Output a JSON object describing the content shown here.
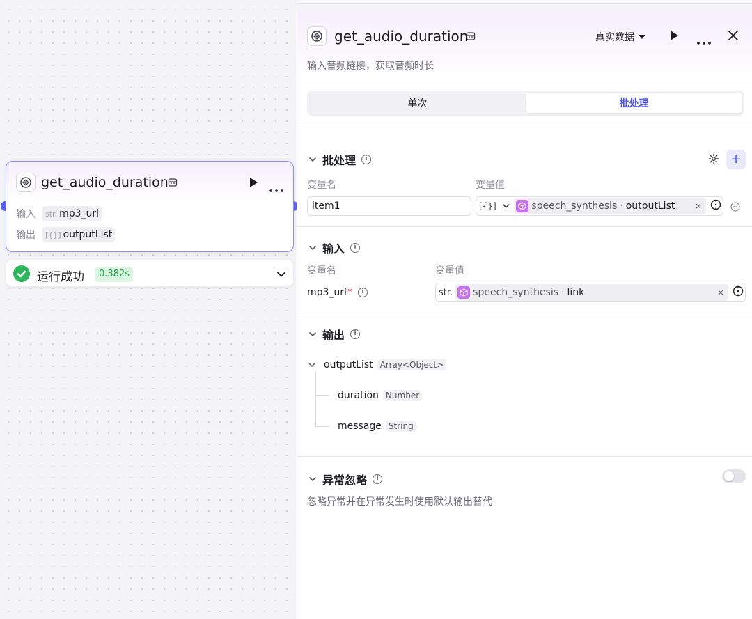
{
  "node": {
    "title": "get_audio_duration",
    "input_label": "输入",
    "input_type": "str.",
    "input_value": "mp3_url",
    "output_label": "输出",
    "output_type": "[{}]",
    "output_value": "outputList"
  },
  "run": {
    "status": "运行成功",
    "time": "0.382s"
  },
  "panel": {
    "title": "get_audio_duration",
    "mode": "真实数据",
    "description": "输入音频链接，获取音频时长",
    "tabs": [
      "单次",
      "批处理"
    ],
    "active_tab": "批处理"
  },
  "batch": {
    "title": "批处理",
    "col_name": "变量名",
    "col_value": "变量值",
    "item_name": "item1",
    "type_selector": "[{}]",
    "ref_node": "speech_synthesis",
    "ref_sep": "·",
    "ref_field": "outputList"
  },
  "inputs": {
    "title": "输入",
    "col_name": "变量名",
    "col_value": "变量值",
    "var_name": "mp3_url",
    "required_mark": "*",
    "type": "str.",
    "ref_node": "speech_synthesis",
    "ref_sep": "·",
    "ref_field": "link"
  },
  "outputs": {
    "title": "输出",
    "root_name": "outputList",
    "root_type": "Array<Object>",
    "children": [
      {
        "name": "duration",
        "type": "Number"
      },
      {
        "name": "message",
        "type": "String"
      }
    ]
  },
  "exception": {
    "title": "异常忽略",
    "description": "忽略异常并在异常发生时使用默认输出替代",
    "enabled": false
  },
  "colors": {
    "accent": "#4d53e8",
    "success": "#2fb55d",
    "ref_icon": "#c96ef0"
  }
}
